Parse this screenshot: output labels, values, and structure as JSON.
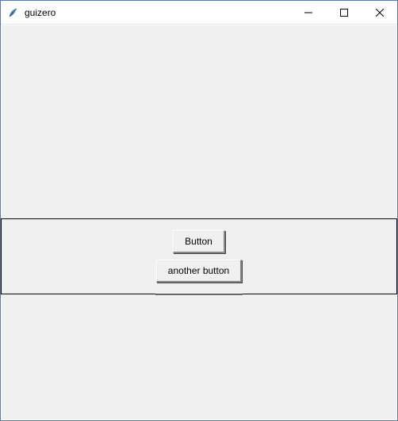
{
  "window": {
    "title": "guizero",
    "icon": "feather-icon"
  },
  "box": {
    "button1_label": "Button",
    "button2_label": "another button"
  }
}
